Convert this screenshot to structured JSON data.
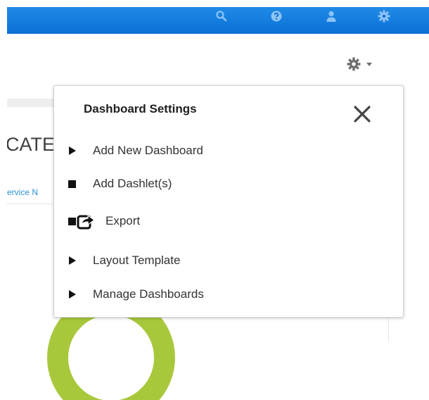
{
  "topbar": {
    "color": "#0a6fd6",
    "icons": [
      "search-icon",
      "help-icon",
      "user-icon",
      "gear-icon"
    ]
  },
  "settings_trigger": {
    "icon": "gear-icon",
    "caret": "chevron-down-icon"
  },
  "background": {
    "heading_fragment": "CATE",
    "link_fragment": "ervice N"
  },
  "panel": {
    "title": "Dashboard Settings",
    "close_icon": "close-icon",
    "items": [
      {
        "label": "Add New Dashboard",
        "icon": "triangle-right-icon"
      },
      {
        "label": "Add Dashlet(s)",
        "icon": "square-icon"
      },
      {
        "label": "Export",
        "icon": "export-icon"
      },
      {
        "label": "Layout Template",
        "icon": "triangle-right-icon"
      },
      {
        "label": "Manage Dashboards",
        "icon": "triangle-right-icon"
      }
    ]
  }
}
